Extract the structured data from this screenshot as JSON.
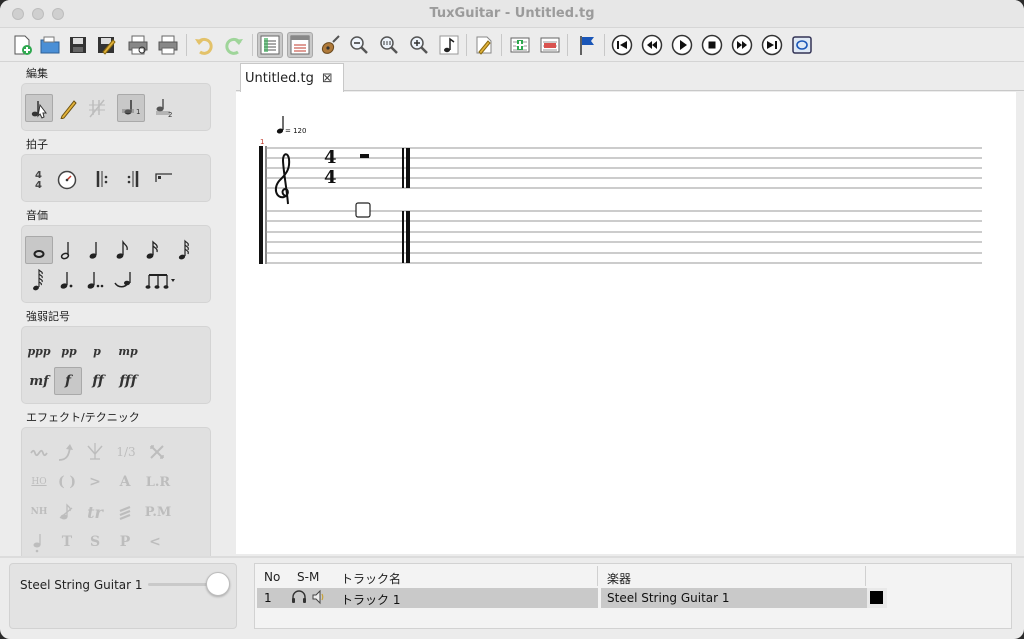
{
  "window": {
    "title": "TuxGuitar - Untitled.tg"
  },
  "sidebar": {
    "sections": {
      "edit": "編集",
      "beat": "拍子",
      "duration": "音価",
      "dynamics": "強弱記号",
      "effects": "エフェクト/テクニック"
    },
    "dynamics": [
      "ppp",
      "pp",
      "p",
      "mp",
      "mf",
      "f",
      "ff",
      "fff"
    ],
    "effects": {
      "row2": [
        "HO",
        "( )",
        ">",
        "A",
        "L.R"
      ],
      "row3": [
        "NH",
        "tr",
        "P.M"
      ],
      "row4": [
        "T",
        "S",
        "P",
        "<"
      ],
      "row1_fraction": "1/3"
    }
  },
  "tabs": [
    {
      "label": "Untitled.tg",
      "close": "⊠"
    }
  ],
  "score": {
    "measure_number": "1",
    "tempo": "= 120",
    "time_signature": {
      "top": "4",
      "bottom": "4"
    }
  },
  "instrument_panel": {
    "track_label": "Steel String Guitar 1",
    "volume": 1.0
  },
  "tracks_table": {
    "headers": {
      "no": "No",
      "sm": "S-M",
      "name": "トラック名",
      "instrument": "楽器"
    },
    "rows": [
      {
        "no": "1",
        "name": "トラック 1",
        "instrument": "Steel String Guitar 1",
        "color": "#000000"
      }
    ]
  }
}
